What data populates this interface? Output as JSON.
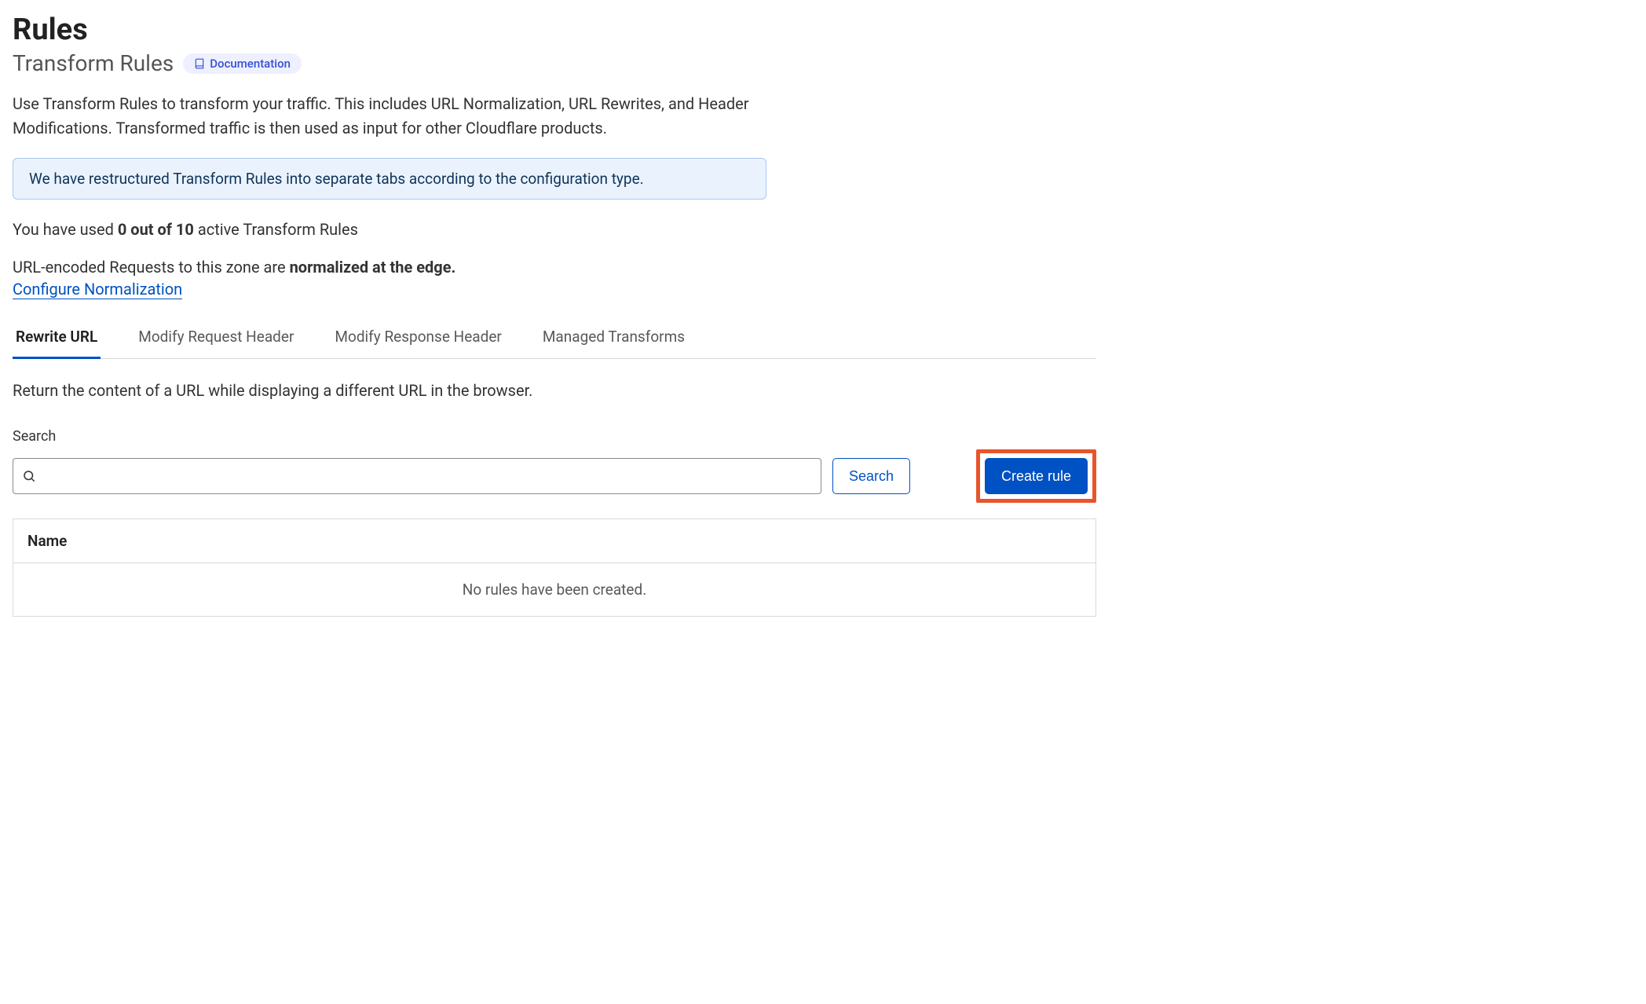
{
  "header": {
    "title": "Rules",
    "subtitle": "Transform Rules",
    "doc_label": "Documentation"
  },
  "description": "Use Transform Rules to transform your traffic. This includes URL Normalization, URL Rewrites, and Header Modifications. Transformed traffic is then used as input for other Cloudflare products.",
  "banner": "We have restructured Transform Rules into separate tabs according to the configuration type.",
  "usage": {
    "prefix": "You have used ",
    "count": "0 out of 10",
    "suffix": " active Transform Rules"
  },
  "normalization": {
    "prefix": "URL-encoded Requests to this zone are ",
    "status": "normalized at the edge.",
    "link": "Configure Normalization"
  },
  "tabs": [
    {
      "label": "Rewrite URL",
      "active": true
    },
    {
      "label": "Modify Request Header",
      "active": false
    },
    {
      "label": "Modify Response Header",
      "active": false
    },
    {
      "label": "Managed Transforms",
      "active": false
    }
  ],
  "tab_description": "Return the content of a URL while displaying a different URL in the browser.",
  "search": {
    "label": "Search",
    "value": "",
    "button": "Search"
  },
  "create_button": "Create rule",
  "table": {
    "columns": [
      "Name"
    ],
    "empty_message": "No rules have been created."
  }
}
